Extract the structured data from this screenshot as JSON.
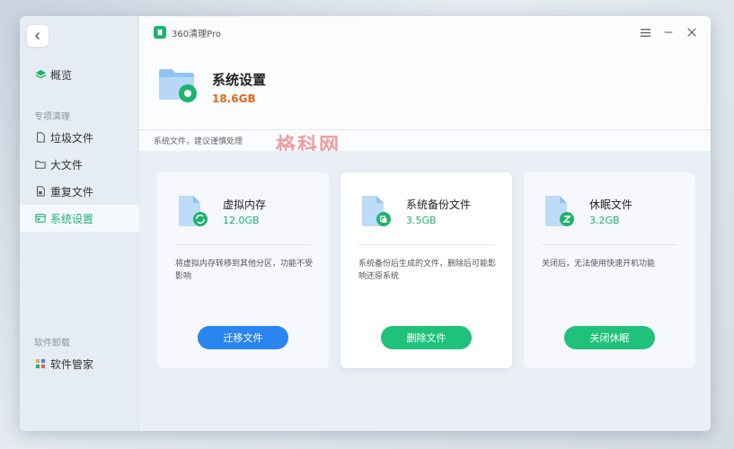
{
  "app": {
    "name": "360清理Pro"
  },
  "sidebar": {
    "overview_label": "概览",
    "section_special": "专项清理",
    "items": [
      {
        "label": "垃圾文件"
      },
      {
        "label": "大文件"
      },
      {
        "label": "重复文件"
      },
      {
        "label": "系统设置"
      }
    ],
    "section_uninstall": "软件卸载",
    "software_manager_label": "软件管家"
  },
  "header": {
    "title": "系统设置",
    "size": "18.6GB",
    "hint": "系统文件，建议谨慎处理"
  },
  "watermark": "格科网",
  "cards": [
    {
      "title": "虚拟内存",
      "size": "12.0GB",
      "desc": "将虚拟内存转移到其他分区，功能不受影响",
      "button": "迁移文件"
    },
    {
      "title": "系统备份文件",
      "size": "3.5GB",
      "desc": "系统备份后生成的文件，删除后可能影响还原系统",
      "button": "删除文件"
    },
    {
      "title": "休眠文件",
      "size": "3.2GB",
      "desc": "关闭后，无法使用快速开机功能",
      "button": "关闭休眠"
    }
  ],
  "colors": {
    "accent_green": "#1fb26e",
    "button_blue": "#2a85f0",
    "button_green": "#1fc27a",
    "size_orange": "#e26a1f"
  }
}
